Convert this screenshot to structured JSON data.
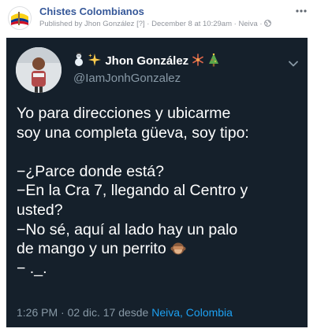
{
  "post": {
    "page_name": "Chistes Colombianos",
    "published_by_prefix": "Published by",
    "author": "Jhon González",
    "help_marker": "[?]",
    "separator": "·",
    "date": "December 8 at 10:29am",
    "location": "Neiva",
    "privacy_icon": "globe-icon",
    "more_icon": "more-options-icon"
  },
  "tweet": {
    "display_name": "Jhon González",
    "handle": "@IamJonhGonzalez",
    "name_emojis": [
      "snowman-icon",
      "sparkles-icon",
      "snowflake-icon",
      "christmas-tree-icon"
    ],
    "body_lines": [
      "Yo para direcciones y ubicarme",
      "soy una completa güeva, soy tipo:",
      "",
      "−¿Parce donde está?",
      "−En la Cra 7, llegando al Centro y",
      "usted?",
      "−No sé, aquí al lado hay un palo",
      "de mango y un perrito",
      "− ._."
    ],
    "body_emoji": "see-no-evil-monkey-icon",
    "timestamp": "1:26 PM · 02 dic. 17",
    "desde": "desde",
    "location": "Neiva, Colombia",
    "colors": {
      "background": "#15202b",
      "text": "#ffffff",
      "secondary": "#8899a6",
      "link": "#1da1f2"
    }
  }
}
